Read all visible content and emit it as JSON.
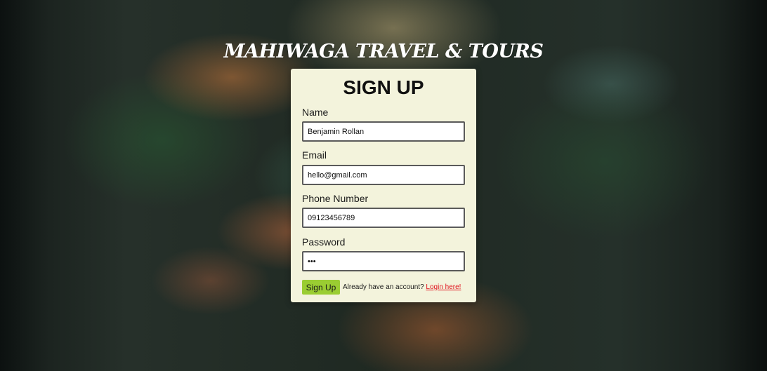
{
  "brand": {
    "title": "MAHIWAGA TRAVEL & TOURS"
  },
  "form": {
    "heading": "SIGN UP",
    "fields": {
      "name": {
        "label": "Name",
        "value": "Benjamin Rollan"
      },
      "email": {
        "label": "Email",
        "value": "hello@gmail.com"
      },
      "phone": {
        "label": "Phone Number",
        "value": "09123456789"
      },
      "password": {
        "label": "Password",
        "value": "abc"
      }
    },
    "submit_label": "Sign Up",
    "login_prompt": "Already have an account?",
    "login_link": "Login here!"
  },
  "colors": {
    "card_bg": "#f3f3dc",
    "button_bg": "#9acd32",
    "link": "#e0141e"
  }
}
